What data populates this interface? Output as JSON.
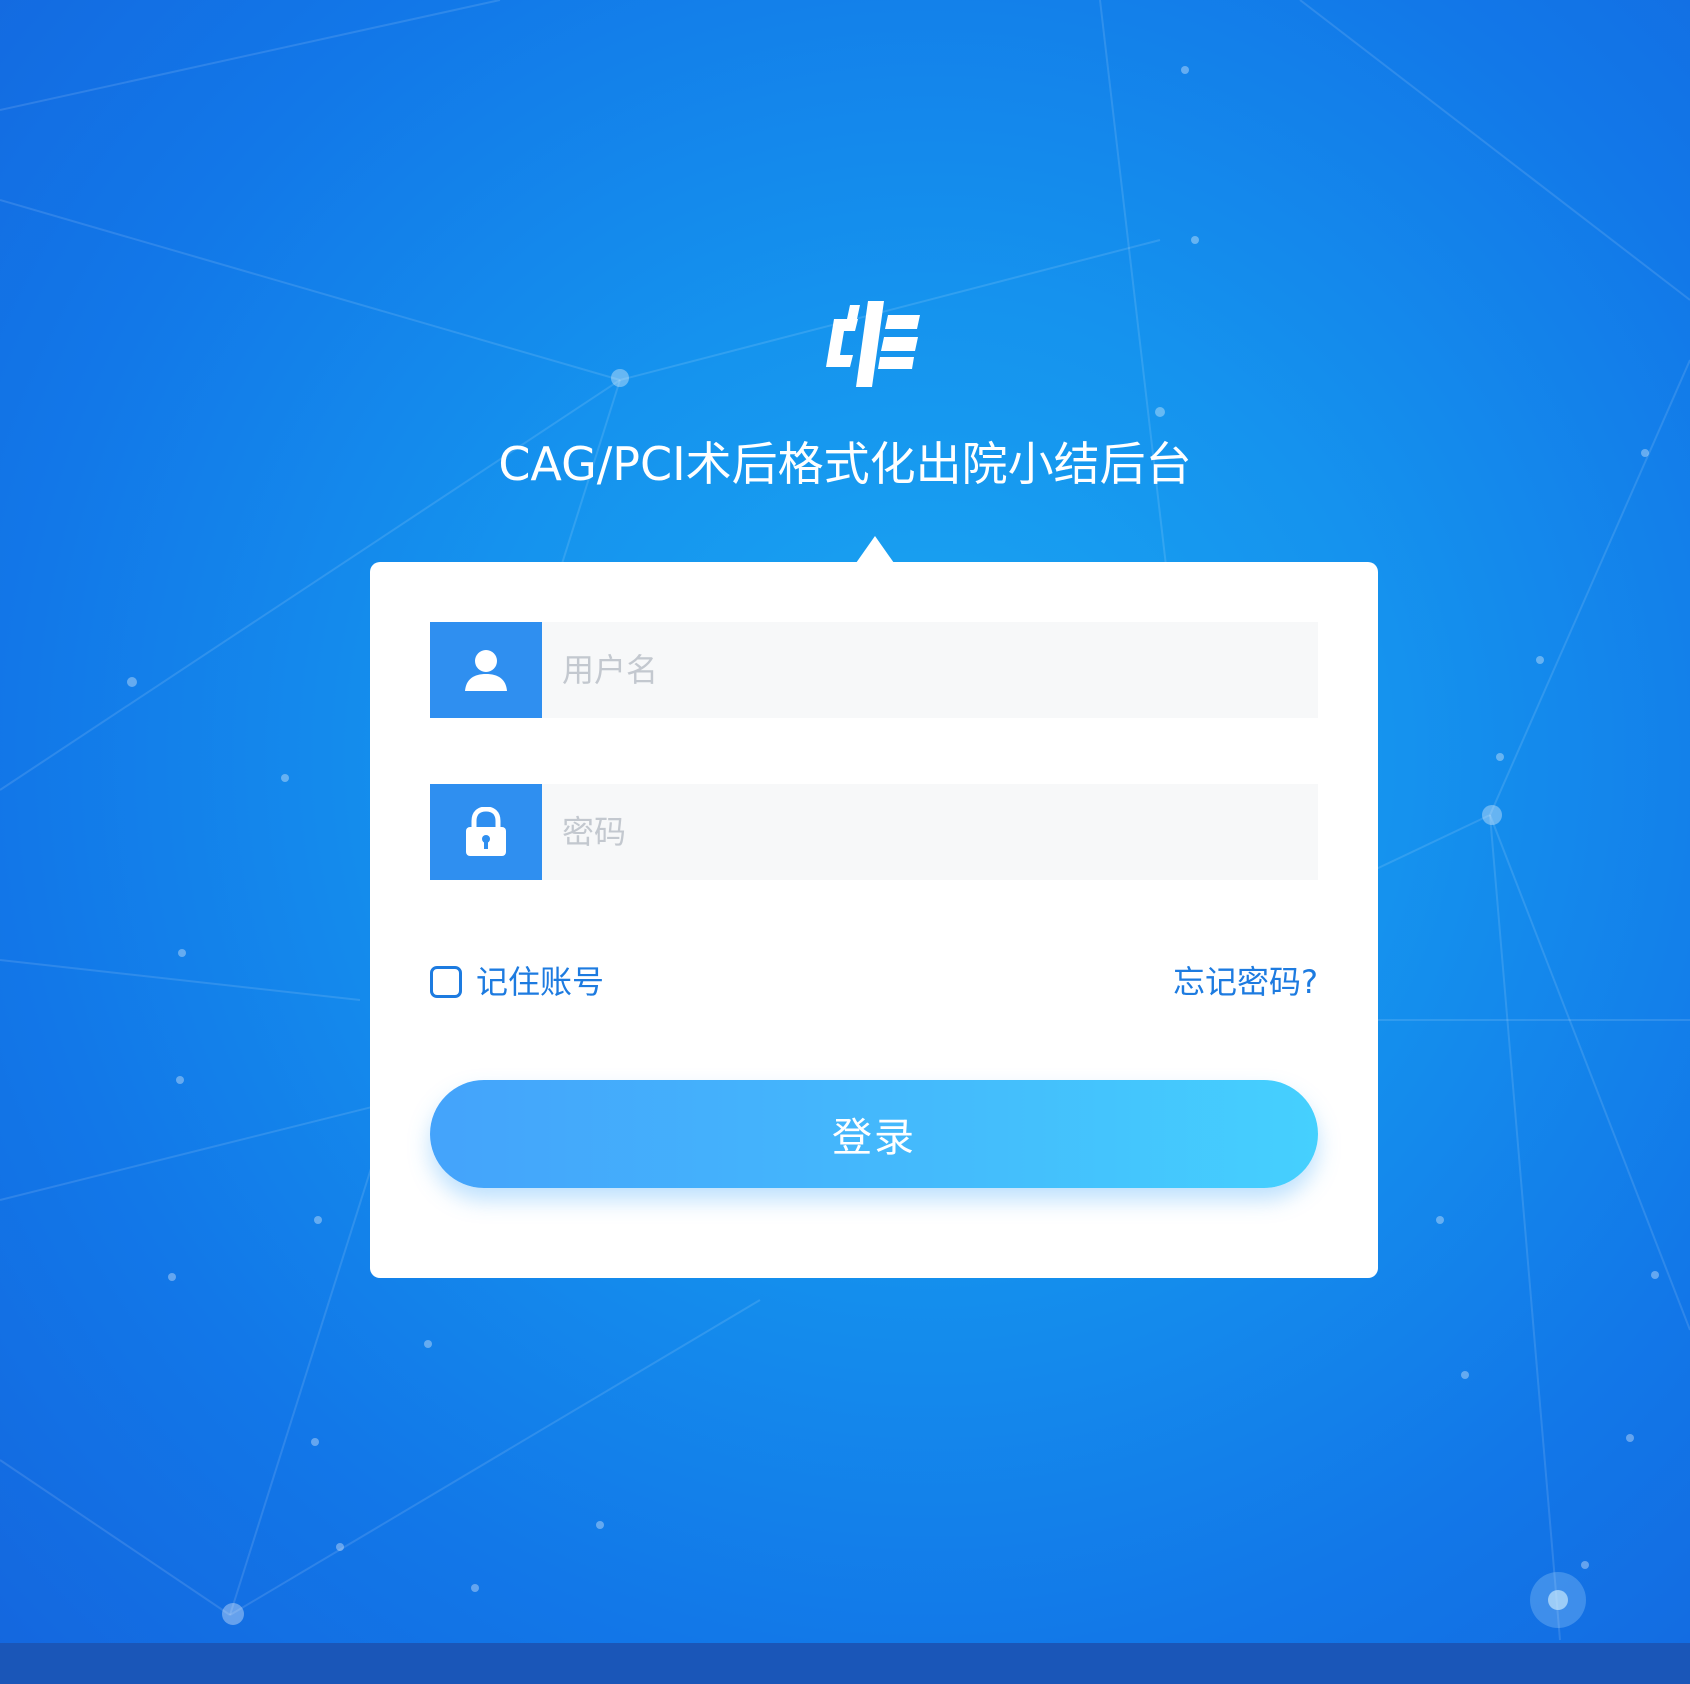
{
  "app": {
    "title": "CAG/PCI术后格式化出院小结后台"
  },
  "login_form": {
    "username": {
      "value": "",
      "placeholder": "用户名",
      "icon": "user-icon"
    },
    "password": {
      "value": "",
      "placeholder": "密码",
      "icon": "lock-icon"
    },
    "remember_label": "记住账号",
    "remember_checked": false,
    "forgot_label": "忘记密码?",
    "submit_label": "登录"
  },
  "colors": {
    "background": "#1593ee",
    "accent": "#2f8ff0",
    "link": "#1d7be0",
    "button_start": "#44a3fb",
    "button_end": "#45d0fe",
    "bottom_bar": "#1a56b8"
  },
  "logo": {
    "icon": "medical-cross-logo-icon"
  }
}
